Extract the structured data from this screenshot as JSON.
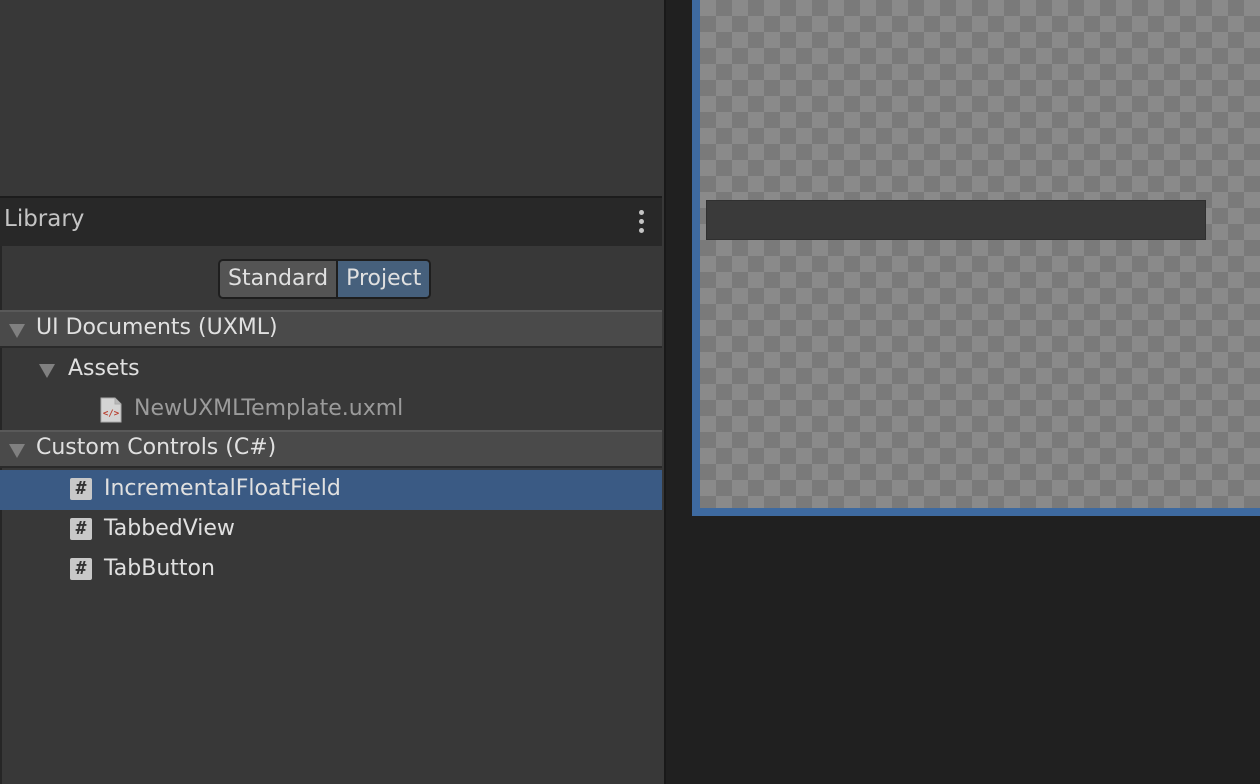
{
  "library": {
    "title": "Library",
    "menu_icon": "kebab-menu-icon",
    "tabs": [
      {
        "label": "Standard",
        "selected": false
      },
      {
        "label": "Project",
        "selected": true
      }
    ]
  },
  "tree": {
    "ui_documents": {
      "label": "UI Documents (UXML)",
      "expanded": true,
      "folders": [
        {
          "label": "Assets",
          "expanded": true,
          "files": [
            {
              "label": "NewUXMLTemplate.uxml",
              "icon": "uxml-file-icon"
            }
          ]
        }
      ]
    },
    "custom_controls": {
      "label": "Custom Controls (C#)",
      "expanded": true,
      "items": [
        {
          "label": "IncrementalFloatField",
          "icon": "csharp-script-icon",
          "selected": true
        },
        {
          "label": "TabbedView",
          "icon": "csharp-script-icon",
          "selected": false
        },
        {
          "label": "TabButton",
          "icon": "csharp-script-icon",
          "selected": false
        }
      ]
    }
  },
  "colors": {
    "selection": "#3a5a84",
    "viewport_border": "#3e6aa0",
    "tab_selected": "#46607c"
  }
}
